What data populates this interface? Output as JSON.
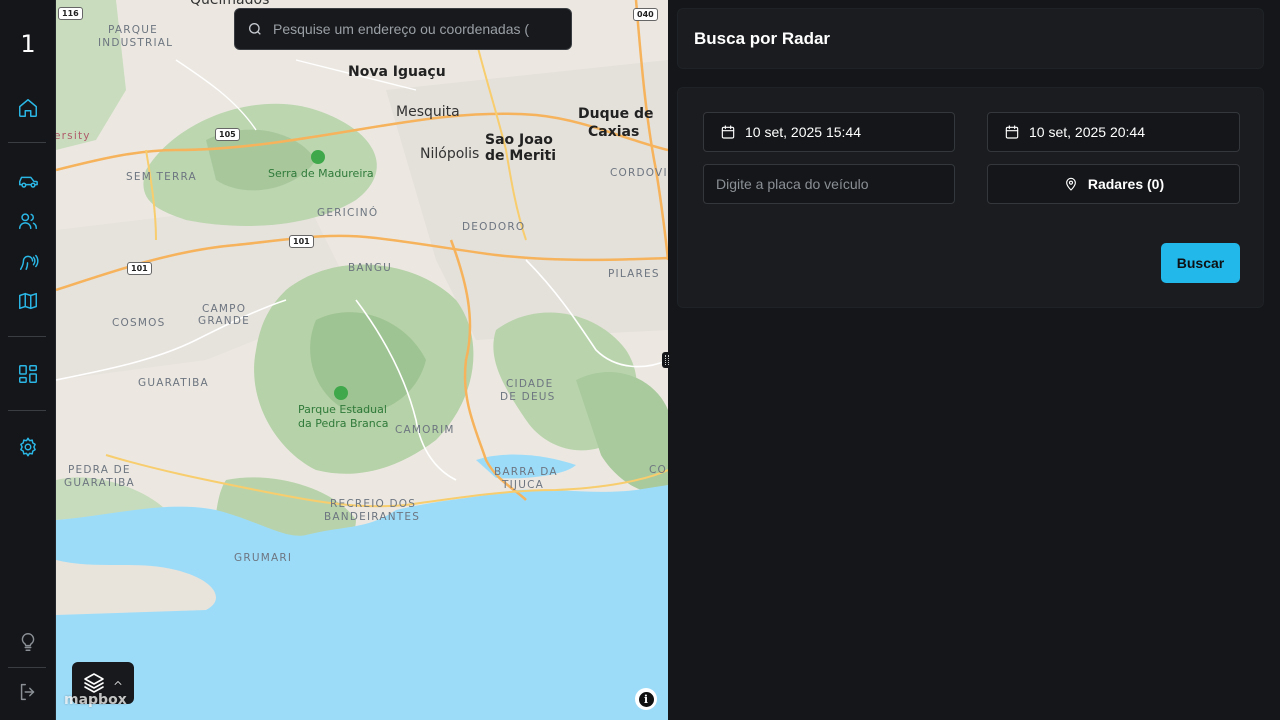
{
  "sidebar": {
    "logo": "1",
    "items": [
      {
        "name": "home",
        "icon": "home-icon"
      },
      {
        "name": "vehicles",
        "icon": "car-icon"
      },
      {
        "name": "people",
        "icon": "users-icon"
      },
      {
        "name": "radar",
        "icon": "radar-icon"
      },
      {
        "name": "map",
        "icon": "map-icon"
      },
      {
        "name": "dashboards",
        "icon": "dashboard-icon"
      },
      {
        "name": "settings",
        "icon": "gear-icon"
      },
      {
        "name": "tips",
        "icon": "lightbulb-icon"
      },
      {
        "name": "logout",
        "icon": "logout-icon"
      }
    ],
    "accent_color": "#2bb7e6"
  },
  "map": {
    "search_placeholder": "Pesquise um endereço ou coordenadas (",
    "attribution": "mapbox",
    "info_label": "i",
    "labels": {
      "queimados": "Queimados",
      "parque_industrial_1": "PARQUE",
      "parque_industrial_2": "INDUSTRIAL",
      "nova_iguacu": "Nova Iguaçu",
      "mesquita": "Mesquita",
      "duque_1": "Duque de",
      "duque_2": "Caxias",
      "sao_joao_1": "Sao Joao",
      "sao_joao_2": "de Meriti",
      "nilopolis": "Nilópolis",
      "university": "ersity",
      "serra": "Serra de Madureira",
      "sem_terra": "SEM TERRA",
      "gericino": "GERICINÓ",
      "cordovil": "CORDOVIL",
      "deodoro": "DEODORO",
      "bangu": "BANGU",
      "pilares": "PILARES",
      "campo_1": "CAMPO",
      "campo_2": "GRANDE",
      "cosmos": "COSMOS",
      "guaratiba": "GUARATIBA",
      "cidade_1": "CIDADE",
      "cidade_2": "DE DEUS",
      "parque_1": "Parque Estadual",
      "parque_2": "da Pedra Branca",
      "camorim": "CAMORIM",
      "pedra_1": "PEDRA DE",
      "pedra_2": "GUARATIBA",
      "barra_1": "BARRA DA",
      "barra_2": "TIJUCA",
      "co": "CO",
      "recreio_1": "RECREIO DOS",
      "recreio_2": "BANDEIRANTES",
      "grumari": "GRUMARI"
    },
    "shields": {
      "s116": "116",
      "s040": "040",
      "s105": "105",
      "s101a": "101",
      "s101b": "101"
    }
  },
  "panel": {
    "title": "Busca por Radar",
    "start_date": "10 set, 2025 15:44",
    "end_date": "10 set, 2025 20:44",
    "plate_placeholder": "Digite a placa do veículo",
    "radars_label": "Radares (0)",
    "search_button": "Buscar"
  }
}
